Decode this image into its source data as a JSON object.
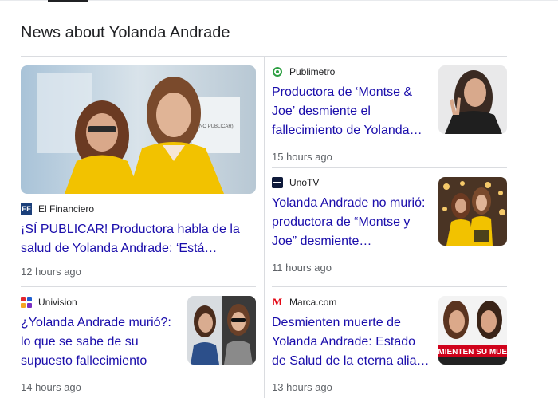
{
  "heading": "News about Yolanda Andrade",
  "articles": [
    {
      "source": "El Financiero",
      "title": "¡SÍ PUBLICAR! Productora habla de la salud de Yolanda Andrade: ‘Está saliendo…",
      "time": "12 hours ago"
    },
    {
      "source": "Publimetro",
      "title": "Productora de ‘Montse & Joe’ desmiente el fallecimiento de Yolanda Andrade",
      "time": "15 hours ago"
    },
    {
      "source": "UnoTV",
      "title": "Yolanda Andrade no murió: productora de “Montse y Joe” desmiente fallecimiento de l…",
      "time": "11 hours ago"
    },
    {
      "source": "Univision",
      "title": "¿Yolanda Andrade murió?: lo que se sabe de su supuesto fallecimiento",
      "time": "14 hours ago"
    },
    {
      "source": "Marca.com",
      "title": "Desmienten muerte de Yolanda Andrade: Estado de Salud de la eterna aliada d…",
      "time": "13 hours ago"
    }
  ],
  "image_text": {
    "banner_word": "SMIENTEN SU MUER",
    "sign_text": "(NO PUBLICAR)",
    "favicon_elfinanciero": "EF",
    "favicon_marca": "M"
  },
  "colors": {
    "link": "#1a0dab",
    "yellow_outfit": "#f2c200"
  }
}
